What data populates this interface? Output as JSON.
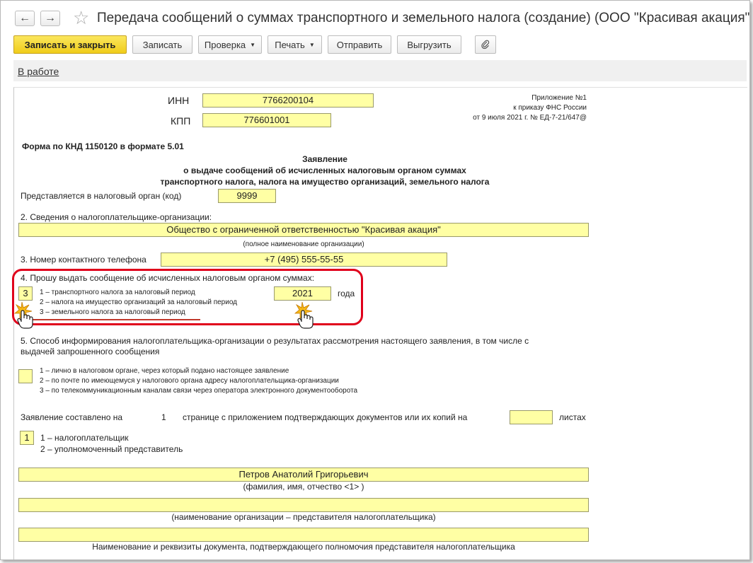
{
  "window": {
    "title": "Передача сообщений о суммах транспортного и земельного налога (создание) (ООО \"Красивая акация\")"
  },
  "toolbar": {
    "save_close": "Записать и закрыть",
    "save": "Записать",
    "check": "Проверка",
    "print": "Печать",
    "send": "Отправить",
    "export": "Выгрузить"
  },
  "status": {
    "link": "В работе"
  },
  "form": {
    "inn_label": "ИНН",
    "inn": "7766200104",
    "kpp_label": "КПП",
    "kpp": "776601001",
    "appendix": [
      "Приложение №1",
      "к приказу ФНС России",
      "от 9 июля 2021 г. № ЕД-7-21/647@"
    ],
    "knd": "Форма по КНД 1150120 в формате 5.01",
    "title_lines": [
      "Заявление",
      "о выдаче сообщений об исчисленных налоговым органом суммах",
      "транспортного налога, налога на имущество организаций, земельного налога"
    ],
    "tax_org_label": "Представляется в налоговый орган (код)",
    "tax_org_code": "9999",
    "s2_label": "2. Сведения о налогоплательщике-организации:",
    "org_name": "Общество с ограниченной ответственностью \"Красивая акация\"",
    "org_name_caption": "(полное наименование организации)",
    "s3_label": "3. Номер контактного телефона",
    "phone": "+7 (495) 555-55-55",
    "s4_label": "4. Прошу выдать сообщение об исчисленных налоговым органом суммах:",
    "s4_code": "3",
    "s4_options": [
      "1 – транспортного налога за налоговый период",
      "2 – налога на имущество организаций за налоговый период",
      "3 – земельного налога за налоговый период"
    ],
    "year": "2021",
    "year_suffix": "года",
    "s5_label_1": "5. Способ информирования налогоплательщика-организации о результатах рассмотрения настоящего заявления, в том числе с",
    "s5_label_2": "выдачей запрошенного сообщения",
    "s5_code": "",
    "s5_options": [
      "1 – лично в налоговом органе, через который подано настоящее заявление",
      "2 – по почте по имеющемуся у налогового органа адресу налогоплательщика-организации",
      "3 – по телекоммуникационным каналам связи через оператора электронного документооборота"
    ],
    "pages_label": "Заявление составлено на",
    "pages_value": "1",
    "pages_text": "странице с приложением подтверждающих документов или их копий на",
    "sheets_value": "",
    "sheets_label": "листах",
    "signer_code": "1",
    "signer_options": [
      "1 – налогоплательщик",
      "2 – уполномоченный представитель"
    ],
    "fio": "Петров Анатолий Григорьевич",
    "fio_caption": "(фамилия, имя, отчество <1> )",
    "rep_org": "",
    "rep_org_caption": "(наименование организации – представителя налогоплательщика)",
    "rep_doc": "",
    "rep_doc_caption": "Наименование и реквизиты документа, подтверждающего полномочия представителя налогоплательщика"
  },
  "colors": {
    "field_bg": "#ffffa4",
    "primary_button": "#f5d532",
    "highlight": "#e0001b"
  }
}
